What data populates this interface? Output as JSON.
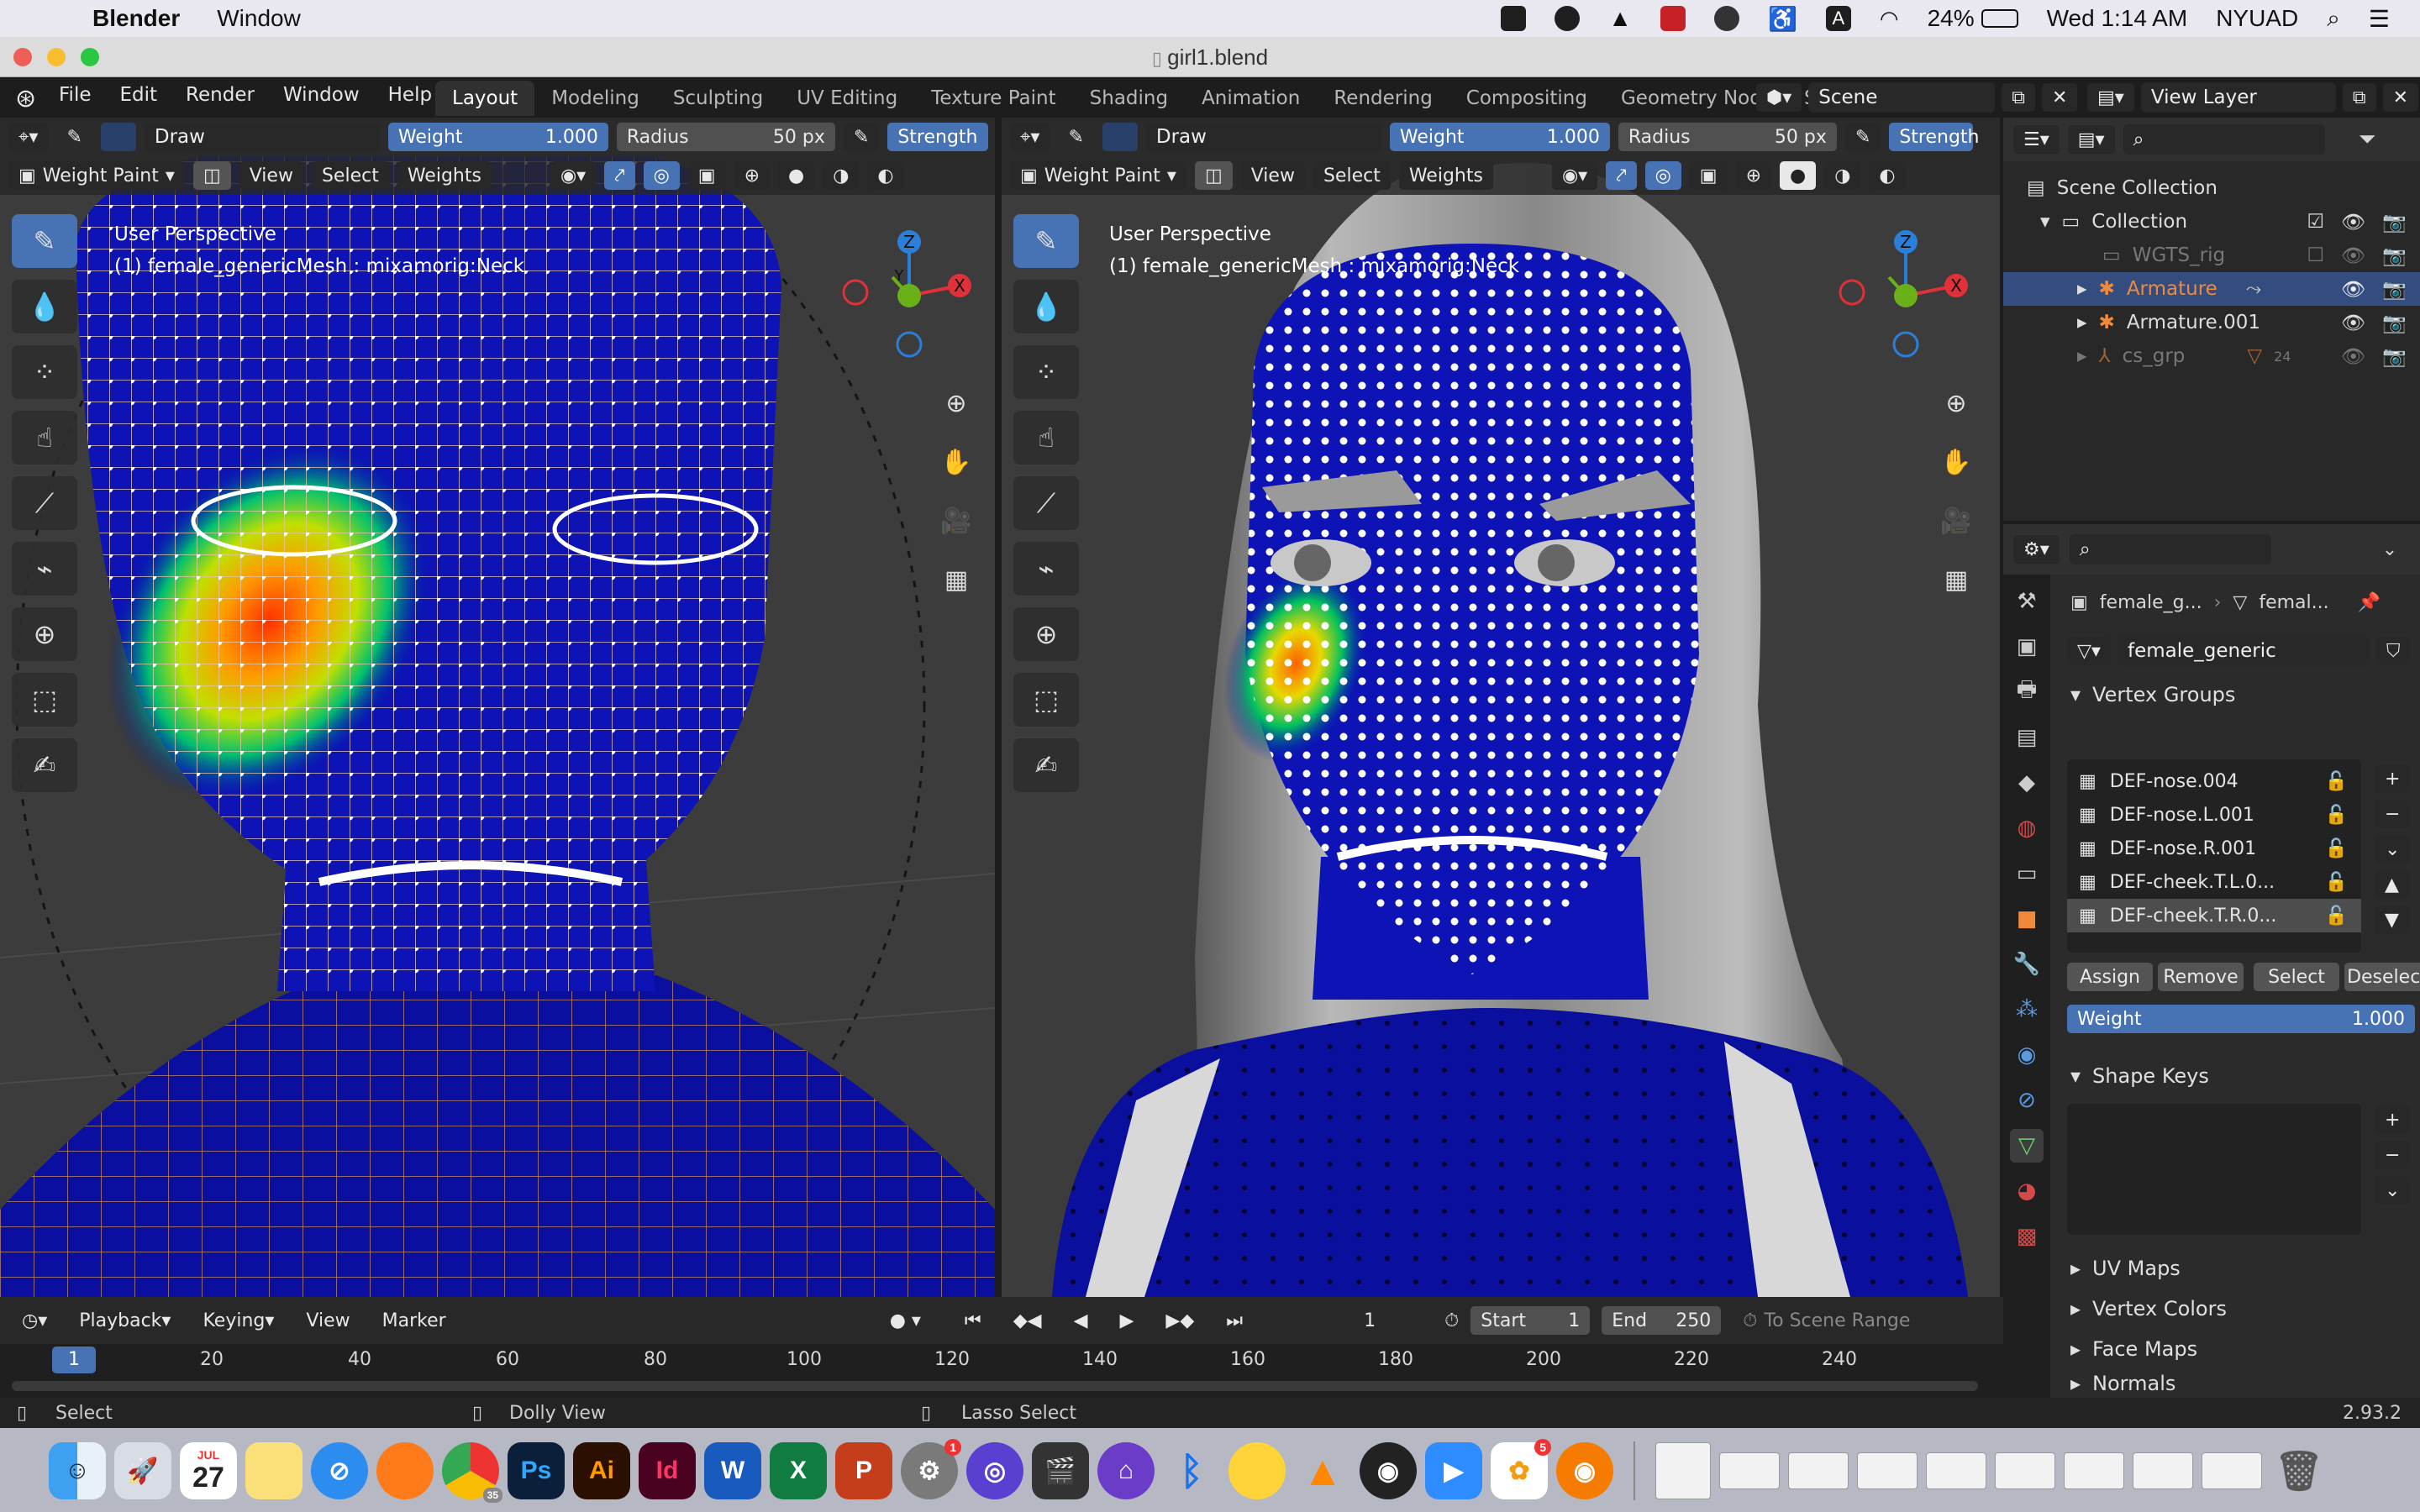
{
  "menubar": {
    "app": "Blender",
    "items": [
      "Window"
    ],
    "battery": "24%",
    "datetime": "Wed 1:14 AM",
    "user": "NYUAD"
  },
  "window": {
    "title": "girl1.blend"
  },
  "topbar": {
    "menu": [
      "File",
      "Edit",
      "Render",
      "Window",
      "Help"
    ],
    "workspaces": [
      "Layout",
      "Modeling",
      "Sculpting",
      "UV Editing",
      "Texture Paint",
      "Shading",
      "Animation",
      "Rendering",
      "Compositing",
      "Geometry Nodes",
      "S"
    ],
    "active_workspace": "Layout",
    "scene": "Scene",
    "view_layer": "View Layer"
  },
  "tool_header": {
    "brush": "Draw",
    "weight_label": "Weight",
    "weight_value": "1.000",
    "radius_label": "Radius",
    "radius_value": "50 px",
    "strength_label": "Strength"
  },
  "viewport_header": {
    "mode": "Weight Paint",
    "menus": [
      "View",
      "Select",
      "Weights"
    ]
  },
  "viewport_left": {
    "perspective": "User Perspective",
    "object_info": "(1) female_genericMesh : mixamorig:Neck"
  },
  "viewport_right": {
    "perspective": "User Perspective",
    "object_info": "(1) female_genericMesh : mixamorig:Neck"
  },
  "gizmo": {
    "x": "X",
    "y": "Y",
    "z": "Z"
  },
  "outliner": {
    "root": "Scene Collection",
    "collection": "Collection",
    "items": [
      {
        "name": "WGTS_rig",
        "dim": true
      },
      {
        "name": "Armature",
        "selected": true
      },
      {
        "name": "Armature.001"
      },
      {
        "name": "cs_grp",
        "dim": true,
        "badge": "24"
      }
    ]
  },
  "properties": {
    "object_name": "female_g...",
    "mesh_name": "femal...",
    "data_name": "female_generic",
    "vertex_groups_title": "Vertex Groups",
    "vertex_groups": [
      "DEF-nose.004",
      "DEF-nose.L.001",
      "DEF-nose.R.001",
      "DEF-cheek.T.L.0...",
      "DEF-cheek.T.R.0..."
    ],
    "selected_group": "DEF-cheek.T.R.0...",
    "buttons": {
      "assign": "Assign",
      "remove": "Remove",
      "select": "Select",
      "deselect": "Deselect"
    },
    "weight_label": "Weight",
    "weight_value": "1.000",
    "shape_keys_title": "Shape Keys",
    "collapsed_panels": [
      "UV Maps",
      "Vertex Colors",
      "Face Maps",
      "Normals"
    ]
  },
  "timeline": {
    "menus": [
      "Playback",
      "Keying",
      "View",
      "Marker"
    ],
    "current_frame": "1",
    "start_label": "Start",
    "start_value": "1",
    "end_label": "End",
    "end_value": "250",
    "scene_range": "To Scene Range",
    "ruler": [
      "1",
      "20",
      "40",
      "60",
      "80",
      "100",
      "120",
      "140",
      "160",
      "180",
      "200",
      "220",
      "240"
    ]
  },
  "statusbar": {
    "select": "Select",
    "dolly": "Dolly View",
    "lasso": "Lasso Select",
    "version": "2.93.2"
  },
  "dock": {
    "calendar_month": "JUL",
    "calendar_day": "27",
    "apps": [
      "Finder",
      "Launchpad",
      "Calendar",
      "Notes",
      "Safari",
      "Firefox",
      "Chrome",
      "Photoshop",
      "Illustrator",
      "InDesign",
      "Word",
      "Excel",
      "PowerPoint",
      "System Preferences",
      "Mail",
      "Final Cut Pro",
      "Arc",
      "Bluetooth",
      "Cyberduck",
      "VLC",
      "Screenshot",
      "Zoom",
      "Photos",
      "Blender"
    ],
    "labels": {
      "ps": "Ps",
      "ai": "Ai",
      "id": "Id"
    },
    "badges": {
      "chrome": "35",
      "syspref": "1",
      "photos": "5"
    }
  }
}
